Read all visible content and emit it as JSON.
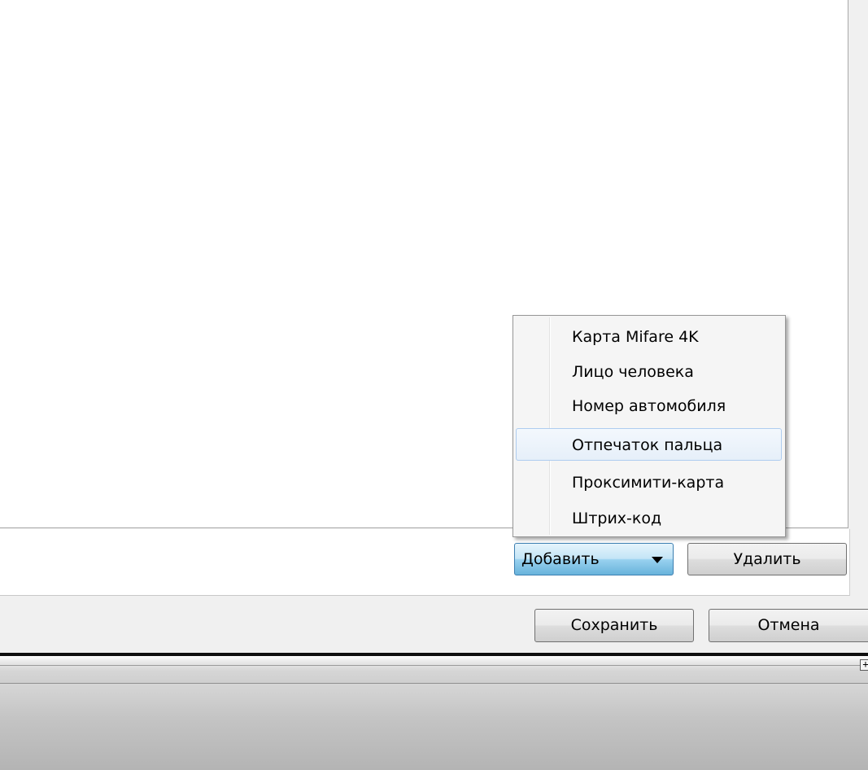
{
  "buttons": {
    "add_label": "Добавить",
    "delete_label": "Удалить",
    "save_label": "Сохранить",
    "cancel_label": "Отмена"
  },
  "add_menu": {
    "items": [
      {
        "label": "Карта Mifare 4K"
      },
      {
        "label": "Лицо человека"
      },
      {
        "label": "Номер автомобиля"
      },
      {
        "label": "Отпечаток пальца",
        "highlighted": true
      },
      {
        "label": "Проксимити-карта"
      },
      {
        "label": "Штрих-код"
      }
    ]
  },
  "strip": {
    "expand_glyph": "+"
  },
  "icons": {
    "dropdown": "chevron-down-icon",
    "expand": "expand-icon"
  }
}
